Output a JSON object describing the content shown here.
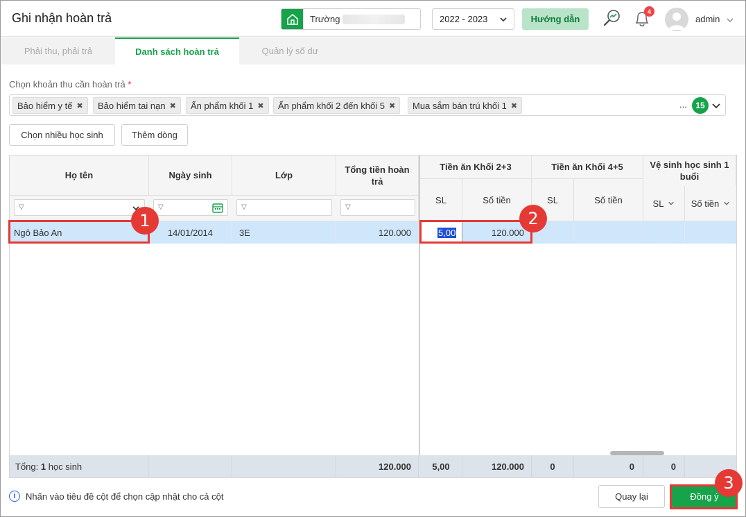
{
  "header": {
    "title": "Ghi nhận hoàn trả",
    "school_label": "Trường",
    "year": "2022 - 2023",
    "guide": "Hướng dẫn",
    "notification_count": "4",
    "username": "admin"
  },
  "tabs": [
    {
      "label": "Phải thu, phải trả"
    },
    {
      "label": "Danh sách hoàn trả"
    },
    {
      "label": "Quản lý số dư"
    }
  ],
  "selector": {
    "label": "Chọn khoản thu cần hoàn trả",
    "required_mark": "*",
    "chips": [
      "Bảo hiểm y tế",
      "Bảo hiểm tai nạn",
      "Ấn phẩm khối 1",
      "Ấn phẩm khối 2 đến khối 5",
      "Mua sắm bán trú khối 1"
    ],
    "more": "...",
    "count": "15"
  },
  "actions": {
    "multi_student": "Chọn nhiều học sinh",
    "add_row": "Thêm dòng"
  },
  "grid": {
    "headers": {
      "name": "Họ tên",
      "dob": "Ngày sinh",
      "class": "Lớp",
      "total": "Tổng tiền hoàn trả",
      "group1": "Tiền ăn Khối 2+3",
      "group2": "Tiền ăn Khối 4+5",
      "group3": "Vệ sinh học sinh 1 buổi",
      "sl": "SL",
      "amount": "Số tiền"
    },
    "row": {
      "name": "Ngô Bảo An",
      "dob": "14/01/2014",
      "class": "3E",
      "total": "120.000",
      "sl": "5,00",
      "amount": "120.000"
    },
    "footer": {
      "label": "Tổng:",
      "count": "1",
      "unit": "học sinh",
      "total": "120.000",
      "g1_sl": "5,00",
      "g1_amount": "120.000",
      "g2_sl": "0",
      "g2_amount": "0",
      "g3_sl": "0"
    }
  },
  "hint": "Nhấn vào tiêu đề cột để chọn cập nhật cho cả cột",
  "buttons": {
    "back": "Quay lại",
    "ok": "Đồng ý"
  },
  "markers": [
    "1",
    "2",
    "3"
  ],
  "colors": {
    "accent": "#16a34a",
    "highlight": "#e53935",
    "selected_row": "#cfe6fb"
  }
}
